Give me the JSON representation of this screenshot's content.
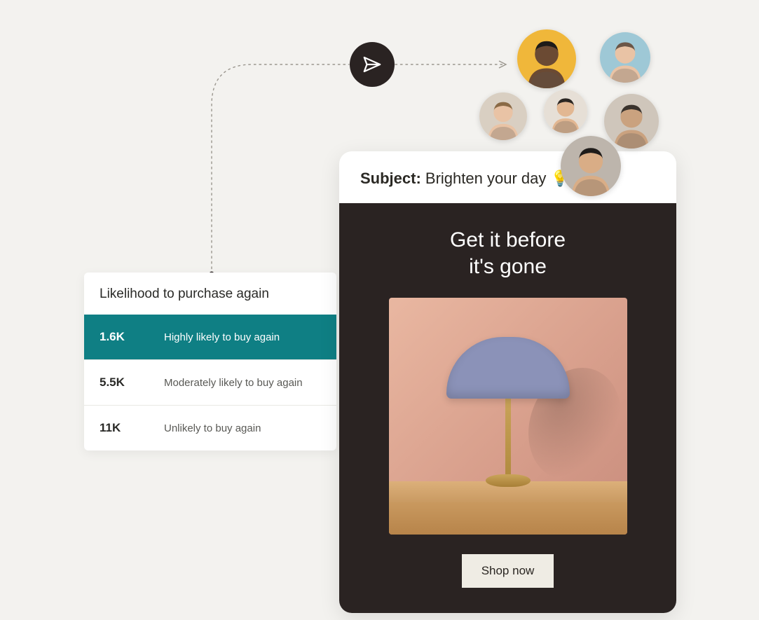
{
  "segment": {
    "title": "Likelihood to purchase again",
    "rows": [
      {
        "count": "1.6K",
        "label": "Highly likely to buy again",
        "active": true
      },
      {
        "count": "5.5K",
        "label": "Moderately likely to buy again",
        "active": false
      },
      {
        "count": "11K",
        "label": "Unlikely to buy again",
        "active": false
      }
    ]
  },
  "email": {
    "subject_label": "Subject:",
    "subject_text": "Brighten your day 💡",
    "headline_line1": "Get it before",
    "headline_line2": "it's gone",
    "cta": "Shop now"
  },
  "icons": {
    "send": "send-icon"
  },
  "avatars": [
    {
      "name": "avatar-1",
      "bg": "#f0b73a",
      "skin": "#6b4a33",
      "hair": "#1d1b19"
    },
    {
      "name": "avatar-2",
      "bg": "#9ec8d6",
      "skin": "#e9c3a5",
      "hair": "#6b5647"
    },
    {
      "name": "avatar-3",
      "bg": "#d9cfc2",
      "skin": "#e9c3a5",
      "hair": "#8a6a46"
    },
    {
      "name": "avatar-4",
      "bg": "#e6dfd6",
      "skin": "#e2b792",
      "hair": "#2b2622"
    },
    {
      "name": "avatar-5",
      "bg": "#cfc6bb",
      "skin": "#caa27f",
      "hair": "#3a332d"
    },
    {
      "name": "avatar-6",
      "bg": "#bdb5ac",
      "skin": "#d9ad86",
      "hair": "#1f1c1a"
    }
  ]
}
